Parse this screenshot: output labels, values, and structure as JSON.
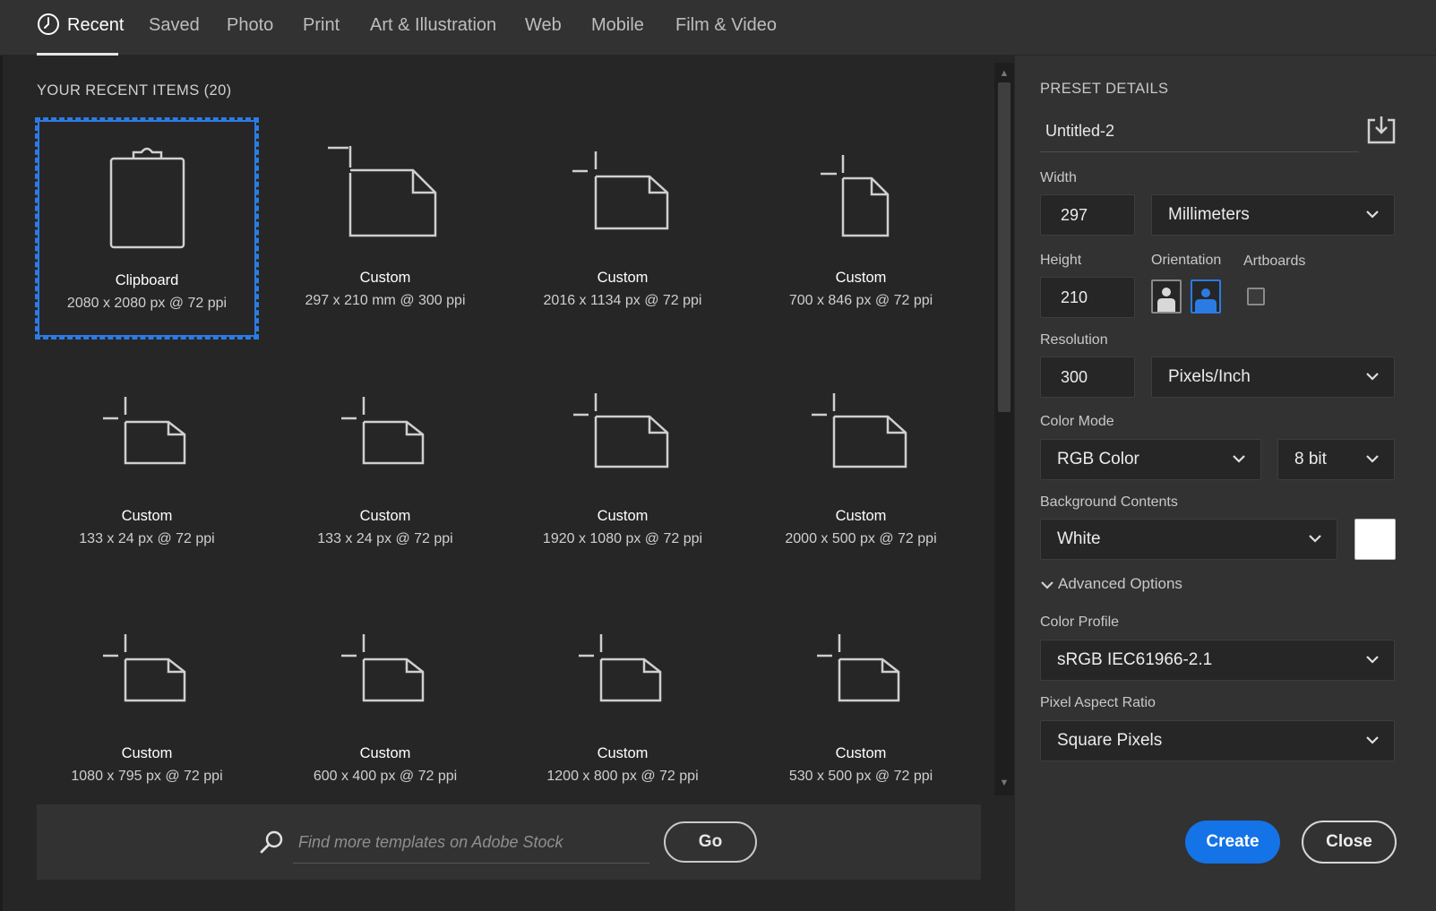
{
  "tabs": [
    {
      "label": "Recent",
      "active": true
    },
    {
      "label": "Saved"
    },
    {
      "label": "Photo"
    },
    {
      "label": "Print"
    },
    {
      "label": "Art & Illustration"
    },
    {
      "label": "Web"
    },
    {
      "label": "Mobile"
    },
    {
      "label": "Film & Video"
    }
  ],
  "recent": {
    "title": "YOUR RECENT ITEMS",
    "count": "(20)",
    "items": [
      {
        "name": "Clipboard",
        "dims": "2080 x 2080 px @ 72 ppi",
        "icon": "clipboard-icon"
      },
      {
        "name": "Custom",
        "dims": "297 x 210 mm @ 300 ppi",
        "icon": "document-icon"
      },
      {
        "name": "Custom",
        "dims": "2016 x 1134 px @ 72 ppi",
        "icon": "document-icon"
      },
      {
        "name": "Custom",
        "dims": "700 x 846 px @ 72 ppi",
        "icon": "document-icon"
      },
      {
        "name": "Custom",
        "dims": "133 x 24 px @ 72 ppi",
        "icon": "document-icon"
      },
      {
        "name": "Custom",
        "dims": "133 x 24 px @ 72 ppi",
        "icon": "document-icon"
      },
      {
        "name": "Custom",
        "dims": "1920 x 1080 px @ 72 ppi",
        "icon": "document-icon"
      },
      {
        "name": "Custom",
        "dims": "2000 x 500 px @ 72 ppi",
        "icon": "document-icon"
      },
      {
        "name": "Custom",
        "dims": "1080 x 795 px @ 72 ppi",
        "icon": "document-icon"
      },
      {
        "name": "Custom",
        "dims": "600 x 400 px @ 72 ppi",
        "icon": "document-icon"
      },
      {
        "name": "Custom",
        "dims": "1200 x 800 px @ 72 ppi",
        "icon": "document-icon"
      },
      {
        "name": "Custom",
        "dims": "530 x 500 px @ 72 ppi",
        "icon": "document-icon"
      }
    ]
  },
  "stock": {
    "placeholder": "Find more templates on Adobe Stock",
    "go_label": "Go"
  },
  "preset": {
    "title": "PRESET DETAILS",
    "name": "Untitled-2",
    "width_label": "Width",
    "width_value": "297",
    "width_unit": "Millimeters",
    "height_label": "Height",
    "height_value": "210",
    "orientation_label": "Orientation",
    "artboards_label": "Artboards",
    "resolution_label": "Resolution",
    "resolution_value": "300",
    "resolution_unit": "Pixels/Inch",
    "color_mode_label": "Color Mode",
    "color_mode": "RGB Color",
    "bit_depth": "8 bit",
    "background_label": "Background Contents",
    "background": "White",
    "background_color": "#ffffff",
    "advanced_label": "Advanced Options",
    "color_profile_label": "Color Profile",
    "color_profile": "sRGB IEC61966-2.1",
    "pixel_aspect_label": "Pixel Aspect Ratio",
    "pixel_aspect": "Square Pixels",
    "create_label": "Create",
    "close_label": "Close"
  },
  "colors": {
    "accent": "#1473e6",
    "selection": "#2c7be5"
  }
}
